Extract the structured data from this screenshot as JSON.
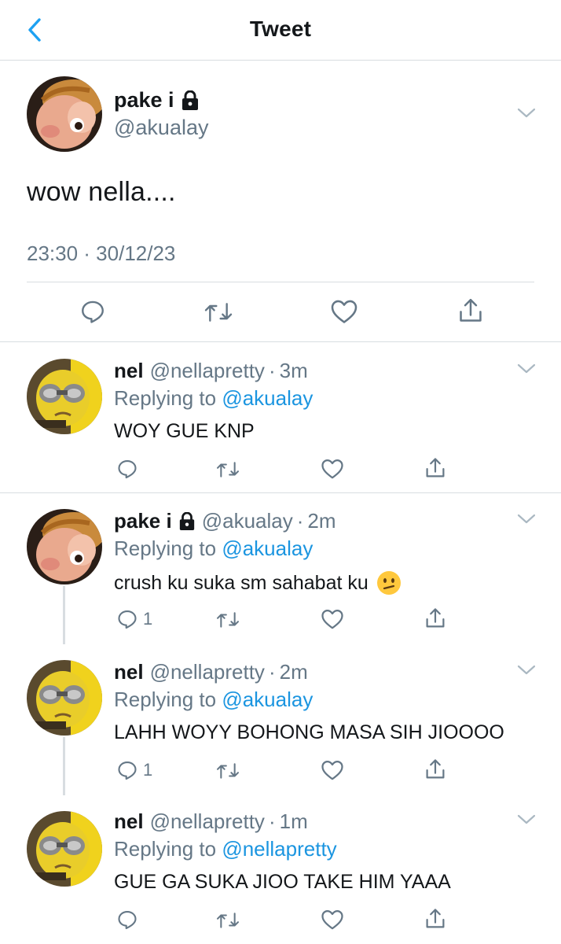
{
  "header": {
    "title": "Tweet",
    "back_icon": "chevron-left-icon"
  },
  "main_tweet": {
    "name": "pake i",
    "handle": "@akualay",
    "text": "wow nella....",
    "timestamp": "23:30 · 30/12/23",
    "protected_icon": "lock-icon"
  },
  "replies": [
    {
      "name": "nel",
      "handle": "@nellapretty",
      "dot": "·",
      "time": "3m",
      "replying_prefix": "Replying to",
      "replying_to": "@akualay",
      "text": "WOY GUE KNP",
      "reply_count": "",
      "emoji": ""
    },
    {
      "name": "pake i",
      "handle": "@akualay",
      "dot": "·",
      "time": "2m",
      "replying_prefix": "Replying to",
      "replying_to": "@akualay",
      "text": "crush ku suka sm sahabat ku",
      "reply_count": "1",
      "emoji": "confused-face"
    },
    {
      "name": "nel",
      "handle": "@nellapretty",
      "dot": "·",
      "time": "2m",
      "replying_prefix": "Replying to",
      "replying_to": "@akualay",
      "text": "LAHH WOYY BOHONG MASA SIH JIOOOO",
      "reply_count": "1",
      "emoji": ""
    },
    {
      "name": "nel",
      "handle": "@nellapretty",
      "dot": "·",
      "time": "1m",
      "replying_prefix": "Replying to",
      "replying_to": "@nellapretty",
      "text": "GUE GA SUKA JIOO TAKE HIM YAAA",
      "reply_count": "",
      "emoji": ""
    }
  ],
  "colors": {
    "accent": "#1da1f2",
    "mention": "#1b95e0",
    "muted": "#657786",
    "divider": "#d8dde1"
  }
}
